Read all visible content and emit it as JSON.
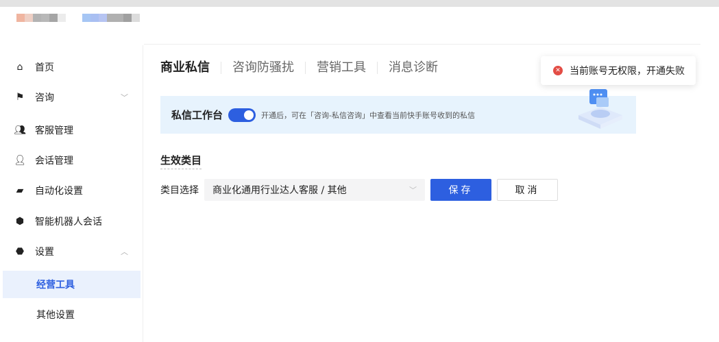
{
  "sidebar": {
    "items": [
      {
        "label": "首页",
        "icon": "home-icon"
      },
      {
        "label": "咨询",
        "icon": "chat-flag-icon"
      },
      {
        "label": "客服管理",
        "icon": "users-icon"
      },
      {
        "label": "会话管理",
        "icon": "user-voice-icon"
      },
      {
        "label": "自动化设置",
        "icon": "message-icon"
      },
      {
        "label": "智能机器人会话",
        "icon": "robot-icon"
      },
      {
        "label": "设置",
        "icon": "settings-icon"
      },
      {
        "label": "经营工具"
      },
      {
        "label": "其他设置"
      }
    ]
  },
  "tabs": [
    "商业私信",
    "咨询防骚扰",
    "营销工具",
    "消息诊断"
  ],
  "toast": {
    "message": "当前账号无权限，开通失败"
  },
  "banner": {
    "title": "私信工作台",
    "toggle_on": true,
    "description": "开通后，可在「咨询-私信咨询」中查看当前快手账号收到的私信"
  },
  "section": {
    "title": "生效类目",
    "field_label": "类目选择",
    "select_value": "商业化通用行业达人客服 / 其他",
    "save": "保存",
    "cancel": "取消"
  },
  "colors": {
    "accent": "#2d5fe0",
    "error": "#e34d45",
    "banner": "#e7f3fd"
  }
}
